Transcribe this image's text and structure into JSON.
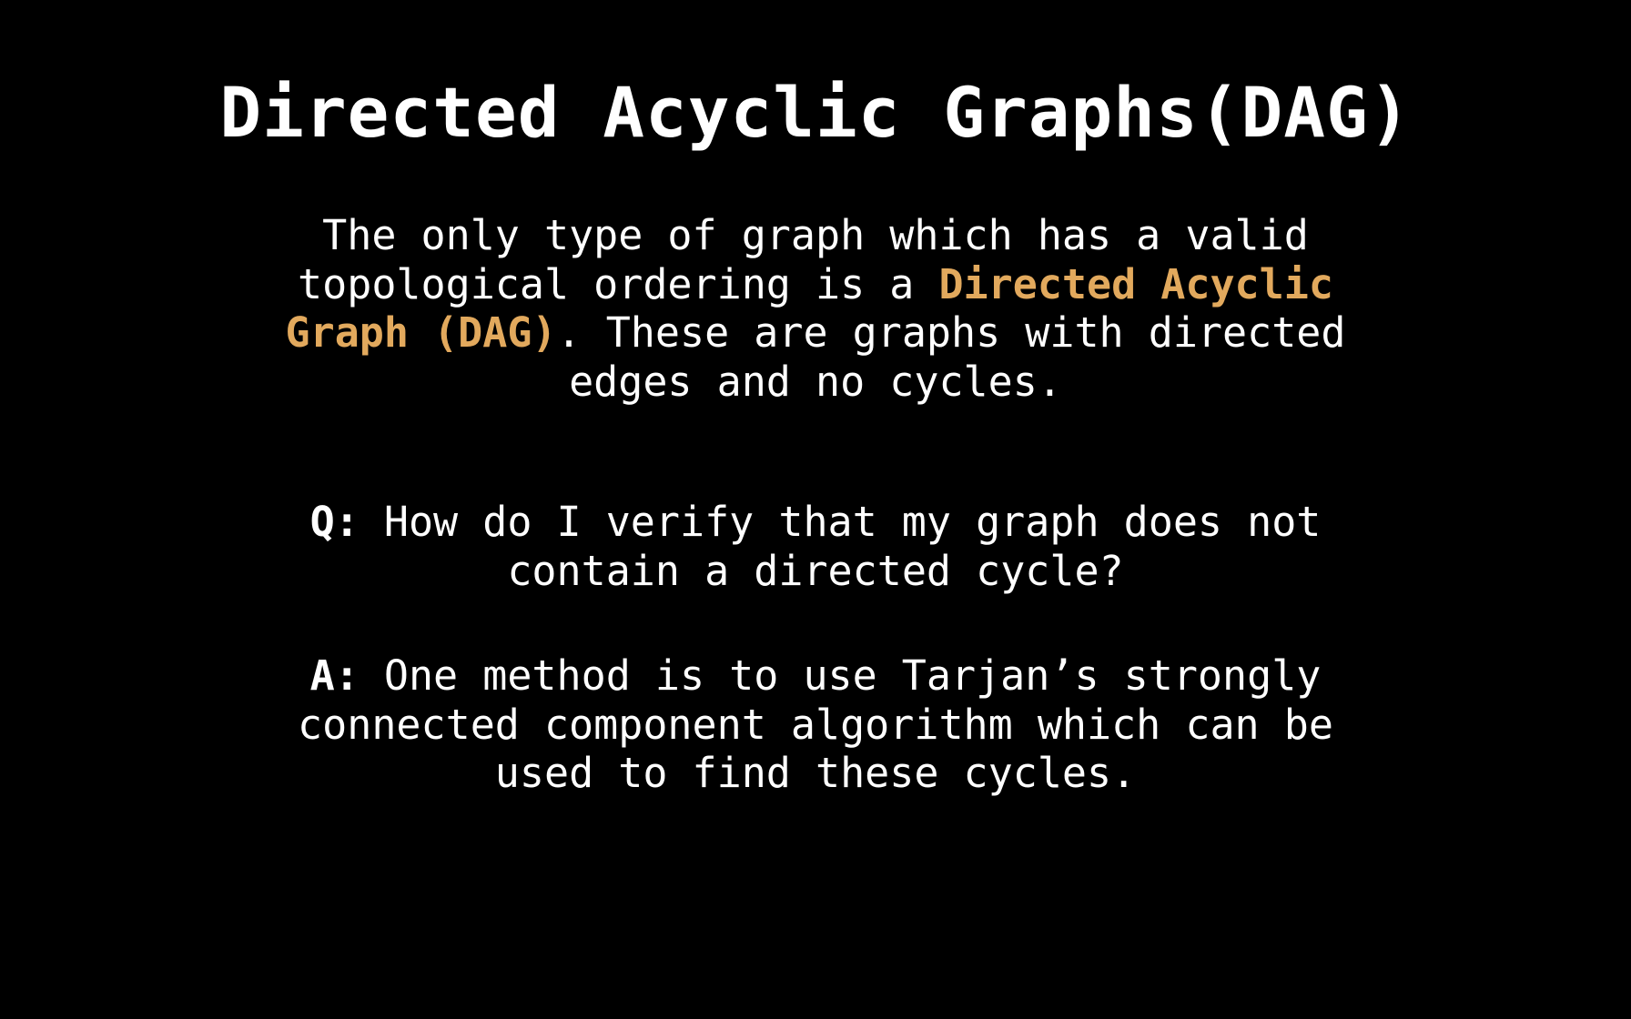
{
  "slide": {
    "title": "Directed Acyclic Graphs(DAG)",
    "intro": {
      "line1": "The only type of graph which has a valid",
      "line2_text": "topological ordering is a ",
      "line2_highlight": "Directed Acyclic",
      "line3_highlight": "Graph (DAG)",
      "line3_text": ". These are graphs with directed",
      "line4": "edges and no cycles."
    },
    "question": {
      "label": "Q:",
      "line1": " How do I verify that my graph does not",
      "line2": "contain a directed cycle?"
    },
    "answer": {
      "label": "A:",
      "line1": " One method is to use Tarjan’s strongly",
      "line2": "connected component algorithm which can be",
      "line3": "used to find these cycles."
    }
  },
  "colors": {
    "background": "#000000",
    "text": "#ffffff",
    "highlight": "#e2a95d"
  }
}
